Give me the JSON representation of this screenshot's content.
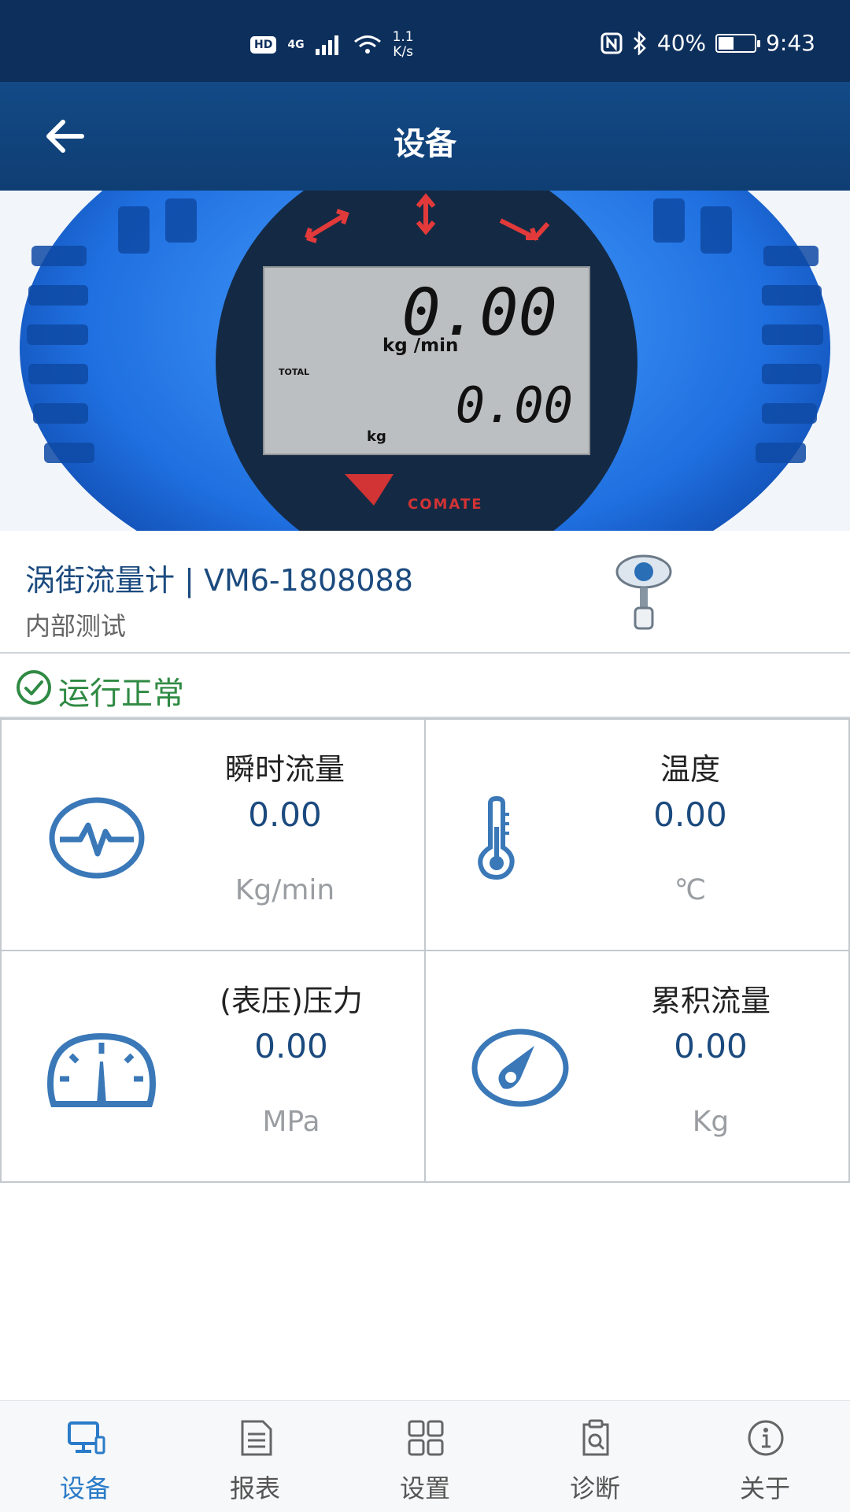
{
  "status_bar": {
    "hd": "HD",
    "network": "4G",
    "speed_top": "1.1",
    "speed_bottom": "K/s",
    "battery": "40%",
    "time": "9:43"
  },
  "header": {
    "title": "设备"
  },
  "hero_display": {
    "rate_value": "0.00",
    "rate_unit": "kg  /min",
    "total_label": "TOTAL",
    "total_value": "0.00",
    "total_unit": "kg",
    "brand": "COMATE"
  },
  "device": {
    "name": "涡街流量计 | VM6-1808088",
    "subtitle": "内部测试"
  },
  "run_status": {
    "text": "运行正常",
    "color": "#2f8a43"
  },
  "metrics": [
    {
      "label": "瞬时流量",
      "value": "0.00",
      "unit": "Kg/min",
      "icon": "pulse-icon"
    },
    {
      "label": "温度",
      "value": "0.00",
      "unit": "℃",
      "icon": "thermometer-icon"
    },
    {
      "label": "(表压)压力",
      "value": "0.00",
      "unit": "MPa",
      "icon": "gauge-icon"
    },
    {
      "label": "累积流量",
      "value": "0.00",
      "unit": "Kg",
      "icon": "dial-icon"
    }
  ],
  "tabs": [
    {
      "label": "设备",
      "icon": "device-icon",
      "active": true
    },
    {
      "label": "报表",
      "icon": "report-icon",
      "active": false
    },
    {
      "label": "设置",
      "icon": "settings-grid-icon",
      "active": false
    },
    {
      "label": "诊断",
      "icon": "diagnose-icon",
      "active": false
    },
    {
      "label": "关于",
      "icon": "info-icon",
      "active": false
    }
  ],
  "colors": {
    "primary": "#134a86",
    "accent": "#2a7bc8",
    "ok": "#2f8a43",
    "icon_blue": "#3a78b8"
  }
}
